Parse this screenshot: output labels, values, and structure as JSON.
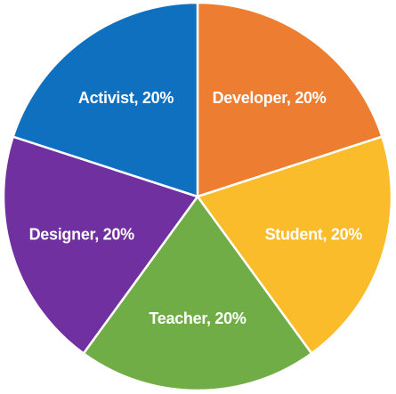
{
  "chart_data": {
    "type": "pie",
    "title": "",
    "slices": [
      {
        "label": "Developer, 20%",
        "category": "Developer",
        "value": 20,
        "color": "#ED7D31"
      },
      {
        "label": "Student, 20%",
        "category": "Student",
        "value": 20,
        "color": "#FBBC2C"
      },
      {
        "label": "Teacher, 20%",
        "category": "Teacher",
        "value": 20,
        "color": "#70AD47"
      },
      {
        "label": "Designer, 20%",
        "category": "Designer",
        "value": 20,
        "color": "#7030A0"
      },
      {
        "label": "Activist, 20%",
        "category": "Activist",
        "value": 20,
        "color": "#1070C0"
      }
    ],
    "start_angle_deg": 0,
    "direction": "clockwise",
    "legend": "none"
  }
}
